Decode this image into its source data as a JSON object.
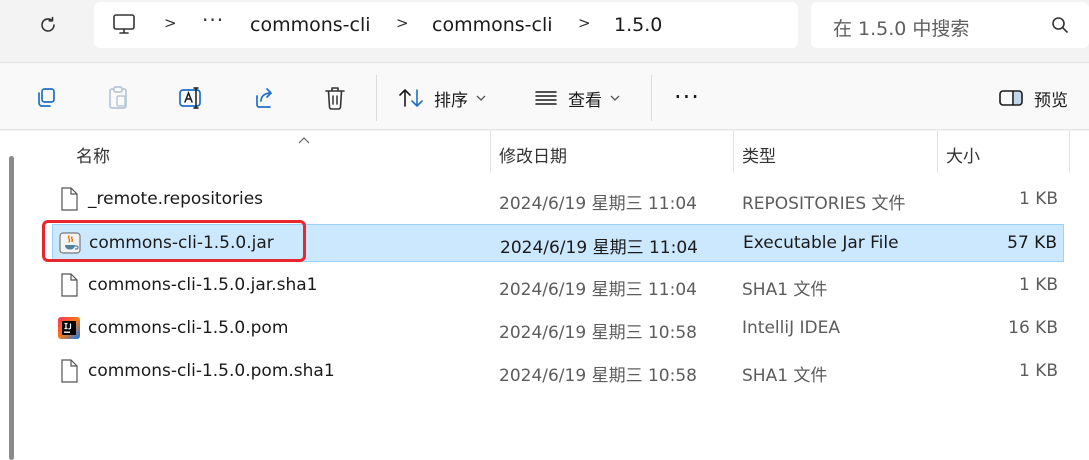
{
  "address": {
    "crumbs": [
      "commons-cli",
      "commons-cli",
      "1.5.0"
    ],
    "overflow": "···",
    "separator": ">"
  },
  "search": {
    "placeholder": "在 1.5.0 中搜索"
  },
  "toolbar": {
    "sort_label": "排序",
    "view_label": "查看",
    "more_label": "···",
    "preview_label": "预览"
  },
  "columns": {
    "name": "名称",
    "date": "修改日期",
    "type": "类型",
    "size": "大小"
  },
  "files": [
    {
      "name": "_remote.repositories",
      "date": "2024/6/19 星期三 11:04",
      "type": "REPOSITORIES 文件",
      "size": "1 KB",
      "icon": "file-icon",
      "selected": false
    },
    {
      "name": "commons-cli-1.5.0.jar",
      "date": "2024/6/19 星期三 11:04",
      "type": "Executable Jar File",
      "size": "57 KB",
      "icon": "java-jar-icon",
      "selected": true
    },
    {
      "name": "commons-cli-1.5.0.jar.sha1",
      "date": "2024/6/19 星期三 11:04",
      "type": "SHA1 文件",
      "size": "1 KB",
      "icon": "file-icon",
      "selected": false
    },
    {
      "name": "commons-cli-1.5.0.pom",
      "date": "2024/6/19 星期三 10:58",
      "type": "IntelliJ IDEA",
      "size": "16 KB",
      "icon": "intellij-icon",
      "selected": false
    },
    {
      "name": "commons-cli-1.5.0.pom.sha1",
      "date": "2024/6/19 星期三 10:58",
      "type": "SHA1 文件",
      "size": "1 KB",
      "icon": "file-icon",
      "selected": false
    }
  ],
  "colors": {
    "selection": "#cce8ff",
    "selection_border": "#99d1ff",
    "annotation": "#e8262e"
  }
}
